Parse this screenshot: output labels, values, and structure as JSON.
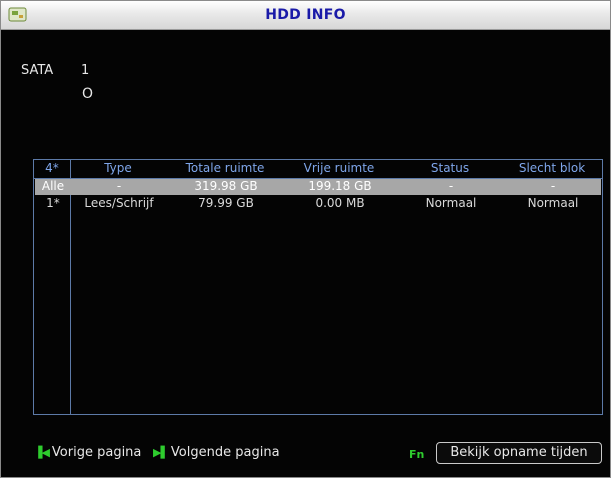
{
  "window": {
    "title": "HDD INFO"
  },
  "sata": {
    "label": "SATA",
    "disk_number": "1",
    "disk_mark": "O"
  },
  "table": {
    "headers": [
      "4*",
      "Type",
      "Totale ruimte",
      "Vrije ruimte",
      "Status",
      "Slecht blok"
    ],
    "rows": [
      {
        "index": "Alle",
        "type": "-",
        "total": "319.98 GB",
        "free": "199.18 GB",
        "status": "-",
        "bad_block": "-",
        "selected": true
      },
      {
        "index": "1*",
        "type": "Lees/Schrijf",
        "total": "79.99 GB",
        "free": "0.00 MB",
        "status": "Normaal",
        "bad_block": "Normaal",
        "selected": false
      }
    ]
  },
  "footer": {
    "prev_icon": "▐◀",
    "prev_label": "Vorige pagina",
    "next_icon": "▶▌",
    "next_label": "Volgende pagina",
    "record_icon": "Fn",
    "view_button_label": "Bekijk opname tijden"
  },
  "colors": {
    "header_text": "#7fa6ea",
    "title_text": "#1a1aa8",
    "selected_row": "#a7a7a7",
    "icon_green": "#2ecc2e"
  }
}
